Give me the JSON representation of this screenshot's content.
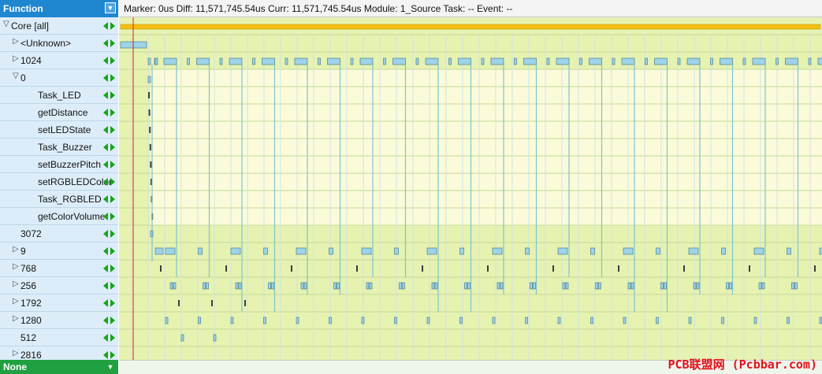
{
  "function_header": {
    "label": "Function"
  },
  "status": {
    "text": "Marker: 0us  Diff: 11,571,745.54us  Curr: 11,571,745.54us  Module: 1_Source  Task: --  Event: --"
  },
  "rows": [
    {
      "label": "Core [all]",
      "twisty": "down",
      "indent": 0
    },
    {
      "label": "<Unknown>",
      "twisty": "right",
      "indent": 1
    },
    {
      "label": "1024",
      "twisty": "right",
      "indent": 1
    },
    {
      "label": "0",
      "twisty": "down",
      "indent": 1
    },
    {
      "label": "Task_LED",
      "twisty": "",
      "indent": 2
    },
    {
      "label": "getDistance",
      "twisty": "",
      "indent": 2
    },
    {
      "label": "setLEDState",
      "twisty": "",
      "indent": 2
    },
    {
      "label": "Task_Buzzer",
      "twisty": "",
      "indent": 2
    },
    {
      "label": "setBuzzerPitch",
      "twisty": "",
      "indent": 2
    },
    {
      "label": "setRGBLEDColor",
      "twisty": "",
      "indent": 2
    },
    {
      "label": "Task_RGBLED",
      "twisty": "",
      "indent": 2
    },
    {
      "label": "getColorVolume",
      "twisty": "",
      "indent": 2
    },
    {
      "label": "3072",
      "twisty": "",
      "indent": 1
    },
    {
      "label": "9",
      "twisty": "right",
      "indent": 1
    },
    {
      "label": "768",
      "twisty": "right",
      "indent": 1
    },
    {
      "label": "256",
      "twisty": "right",
      "indent": 1
    },
    {
      "label": "1792",
      "twisty": "right",
      "indent": 1
    },
    {
      "label": "1280",
      "twisty": "right",
      "indent": 1
    },
    {
      "label": "512",
      "twisty": "",
      "indent": 1
    },
    {
      "label": "2816",
      "twisty": "right",
      "indent": 1
    }
  ],
  "filter": {
    "label": "None"
  },
  "watermark": {
    "text": "PCB联盟网 (Pcbbar.com)"
  },
  "colors": {
    "header_blue": "#1f86d0",
    "row_bg": "#dcedf9",
    "timeline_bg": "#e6f2b0",
    "timeline_highlight": "#fbfbd9",
    "core_bar": "#f5bf14",
    "block_fill": "#9fd3e7",
    "nav_green": "#1aa31a",
    "none_green": "#21a041",
    "marker_red": "#e02020"
  }
}
